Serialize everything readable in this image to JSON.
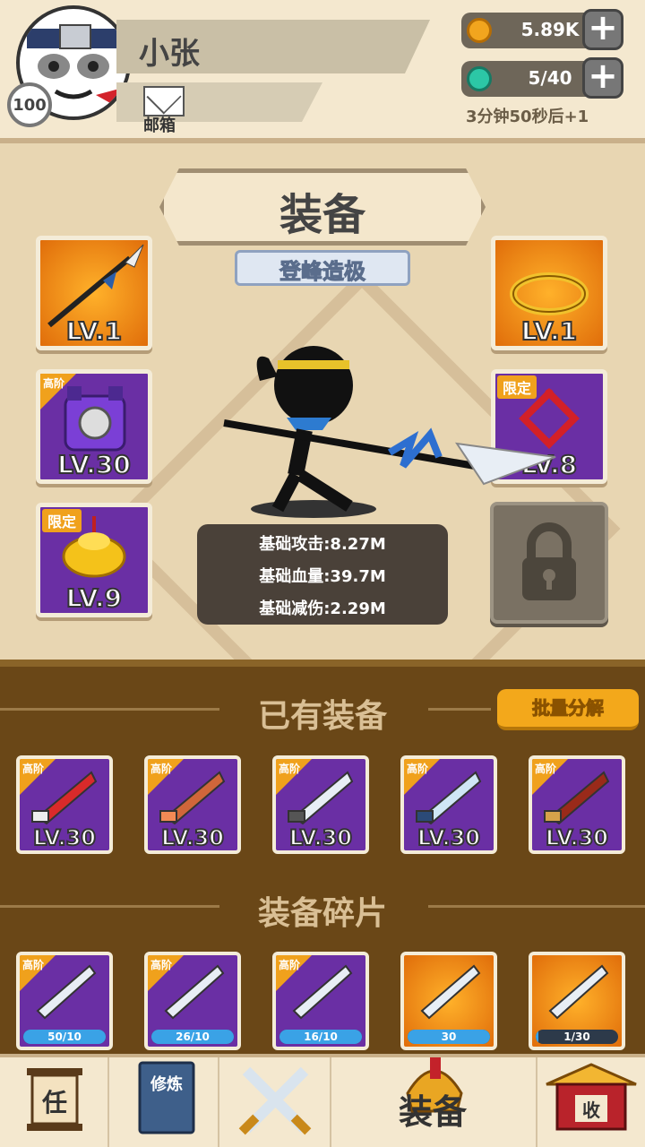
{
  "player": {
    "name": "小张",
    "level": "100",
    "mail_label": "邮箱"
  },
  "resources": {
    "coins": "5.89K",
    "energy": "5/40",
    "timer": "3分钟50秒后+1"
  },
  "equip": {
    "title": "装备",
    "subtitle": "登峰造极",
    "slots_left": [
      {
        "lv": "LV.1",
        "tag": ""
      },
      {
        "lv": "LV.30",
        "tag": "高阶"
      },
      {
        "lv": "LV.9",
        "tag": "限定"
      }
    ],
    "slots_right": [
      {
        "lv": "LV.1",
        "tag": ""
      },
      {
        "lv": "LV.8",
        "tag": "限定"
      }
    ],
    "stats": [
      "基础攻击:8.27M",
      "基础血量:39.7M",
      "基础减伤:2.29M"
    ]
  },
  "owned": {
    "title": "已有装备",
    "batch_button": "批量分解",
    "items": [
      {
        "tag": "高阶",
        "lv": "LV.30",
        "icon": "red-gauntlet-icon"
      },
      {
        "tag": "高阶",
        "lv": "LV.30",
        "icon": "bronze-sword-icon"
      },
      {
        "tag": "高阶",
        "lv": "LV.30",
        "icon": "curved-blade-icon"
      },
      {
        "tag": "高阶",
        "lv": "LV.30",
        "icon": "blue-blade-icon"
      },
      {
        "tag": "高阶",
        "lv": "LV.30",
        "icon": "straw-hat-icon"
      }
    ]
  },
  "fragments": {
    "title": "装备碎片",
    "items": [
      {
        "tag": "高阶",
        "progress": "50/10",
        "fill": 1.0
      },
      {
        "tag": "高阶",
        "progress": "26/10",
        "fill": 1.0
      },
      {
        "tag": "高阶",
        "progress": "16/10",
        "fill": 1.0
      },
      {
        "tag": "",
        "progress": "30",
        "fill": 1.0
      },
      {
        "tag": "",
        "progress": "1/30",
        "fill": 0.033
      }
    ]
  },
  "nav": {
    "task": "任",
    "train": "修炼",
    "active": "装备",
    "collect": "收"
  }
}
